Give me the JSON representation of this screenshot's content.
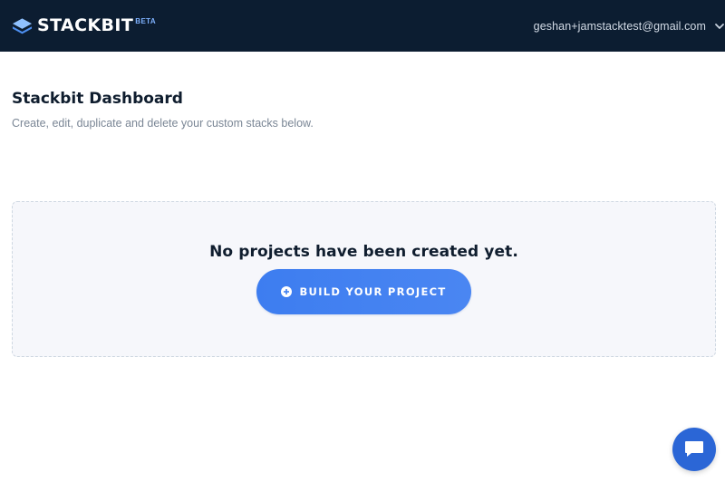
{
  "header": {
    "brand_name": "STACKBIT",
    "brand_badge": "BETA",
    "logo_icon": "stackbit-logo-icon",
    "account_email": "geshan+jamstacktest@gmail.com",
    "account_menu_icon": "chevron-down-icon",
    "background_color": "#0c1d31"
  },
  "main": {
    "title": "Stackbit Dashboard",
    "subtitle": "Create, edit, duplicate and delete your custom stacks below."
  },
  "empty_state": {
    "message": "No projects have been created yet.",
    "button_label": "BUILD YOUR PROJECT",
    "button_icon": "plus-circle-icon",
    "button_color": "#3d7df0"
  },
  "chat": {
    "icon": "chat-icon",
    "color": "#2b66d6"
  }
}
